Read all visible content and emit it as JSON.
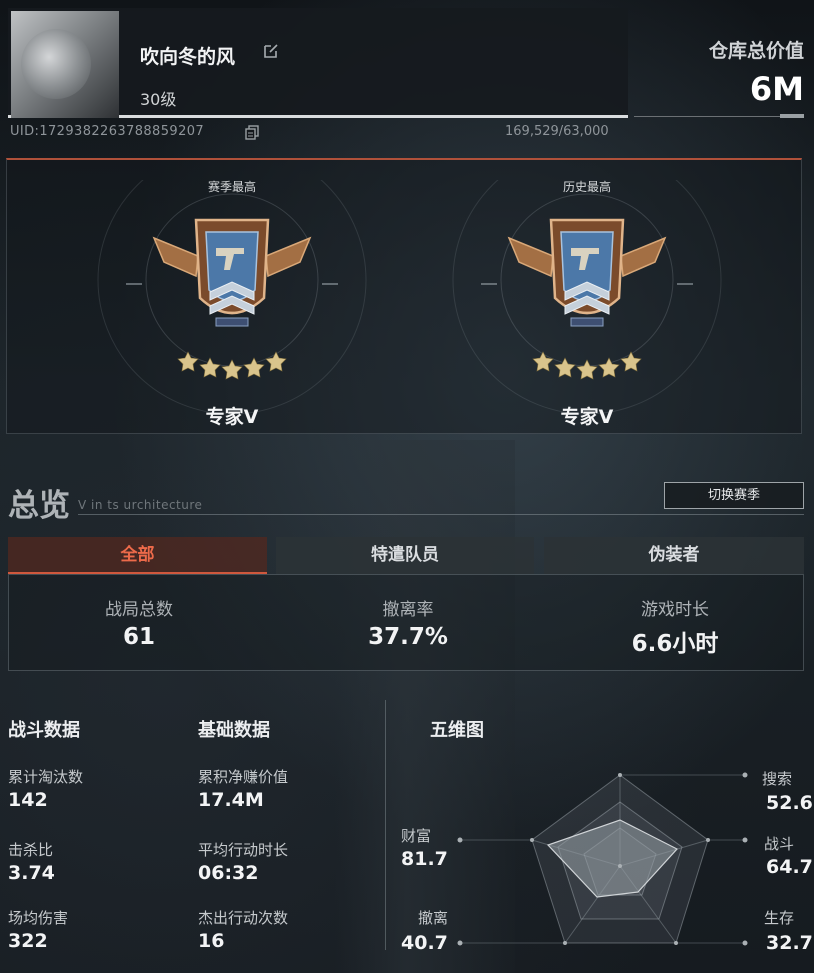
{
  "profile": {
    "username": "吹向冬的风",
    "level": "30级",
    "uid": "UID:1729382263788859207",
    "capacity": "169,529/63,000"
  },
  "warehouse": {
    "label": "仓库总价值",
    "value": "6M"
  },
  "ranks": [
    {
      "caption": "赛季最高",
      "name": "专家V",
      "stars": 5
    },
    {
      "caption": "历史最高",
      "name": "专家V",
      "stars": 5
    }
  ],
  "overview": {
    "title": "总览",
    "subtitle": "V in ts urchitecture",
    "switch_season": "切换赛季",
    "tabs": [
      "全部",
      "特遣队员",
      "伪装者"
    ],
    "active_tab": 0,
    "stats": [
      {
        "label": "战局总数",
        "value": "61"
      },
      {
        "label": "撤离率",
        "value": "37.7%"
      },
      {
        "label": "游戏时长",
        "value": "6.6小时"
      }
    ]
  },
  "combat": {
    "title": "战斗数据",
    "items": [
      {
        "label": "累计淘汰数",
        "value": "142"
      },
      {
        "label": "击杀比",
        "value": "3.74"
      },
      {
        "label": "场均伤害",
        "value": "322"
      }
    ]
  },
  "basic": {
    "title": "基础数据",
    "items": [
      {
        "label": "累积净赚价值",
        "value": "17.4M"
      },
      {
        "label": "平均行动时长",
        "value": "06:32"
      },
      {
        "label": "杰出行动次数",
        "value": "16"
      }
    ]
  },
  "radar": {
    "title": "五维图",
    "axes": [
      {
        "label": "搜索",
        "value": "52.6"
      },
      {
        "label": "战斗",
        "value": "64.7"
      },
      {
        "label": "生存",
        "value": "32.7"
      },
      {
        "label": "撤离",
        "value": "40.7"
      },
      {
        "label": "财富",
        "value": "81.7"
      }
    ]
  },
  "colors": {
    "accent": "#d0583d",
    "background": "#14181c"
  }
}
